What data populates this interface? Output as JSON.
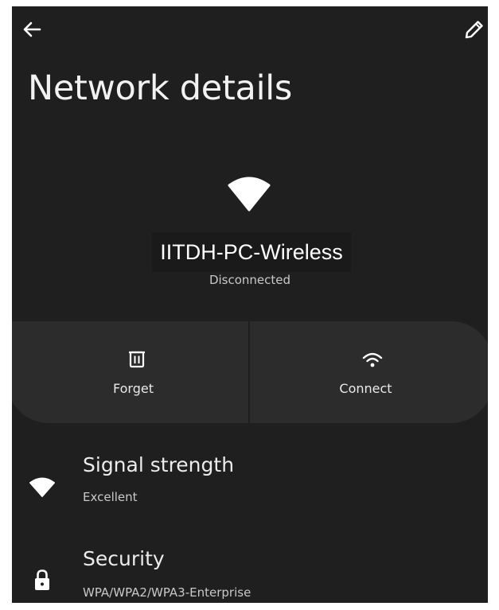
{
  "header": {
    "back_icon": "arrow-left-icon",
    "edit_icon": "pencil-icon",
    "title": "Network details"
  },
  "network": {
    "icon": "wifi-filled-icon",
    "name": "IITDH-PC-Wireless",
    "status": "Disconnected"
  },
  "actions": [
    {
      "icon": "trash-icon",
      "label": "Forget"
    },
    {
      "icon": "wifi-icon",
      "label": "Connect"
    }
  ],
  "details": [
    {
      "icon": "wifi-filled-icon",
      "title": "Signal strength",
      "value": "Excellent"
    },
    {
      "icon": "lock-icon",
      "title": "Security",
      "value": "WPA/WPA2/WPA3-Enterprise"
    }
  ],
  "colors": {
    "background": "#1f1f1f",
    "button_surface": "#2c2c2c",
    "text_primary": "#ececec",
    "text_secondary": "#c9c9c9"
  }
}
